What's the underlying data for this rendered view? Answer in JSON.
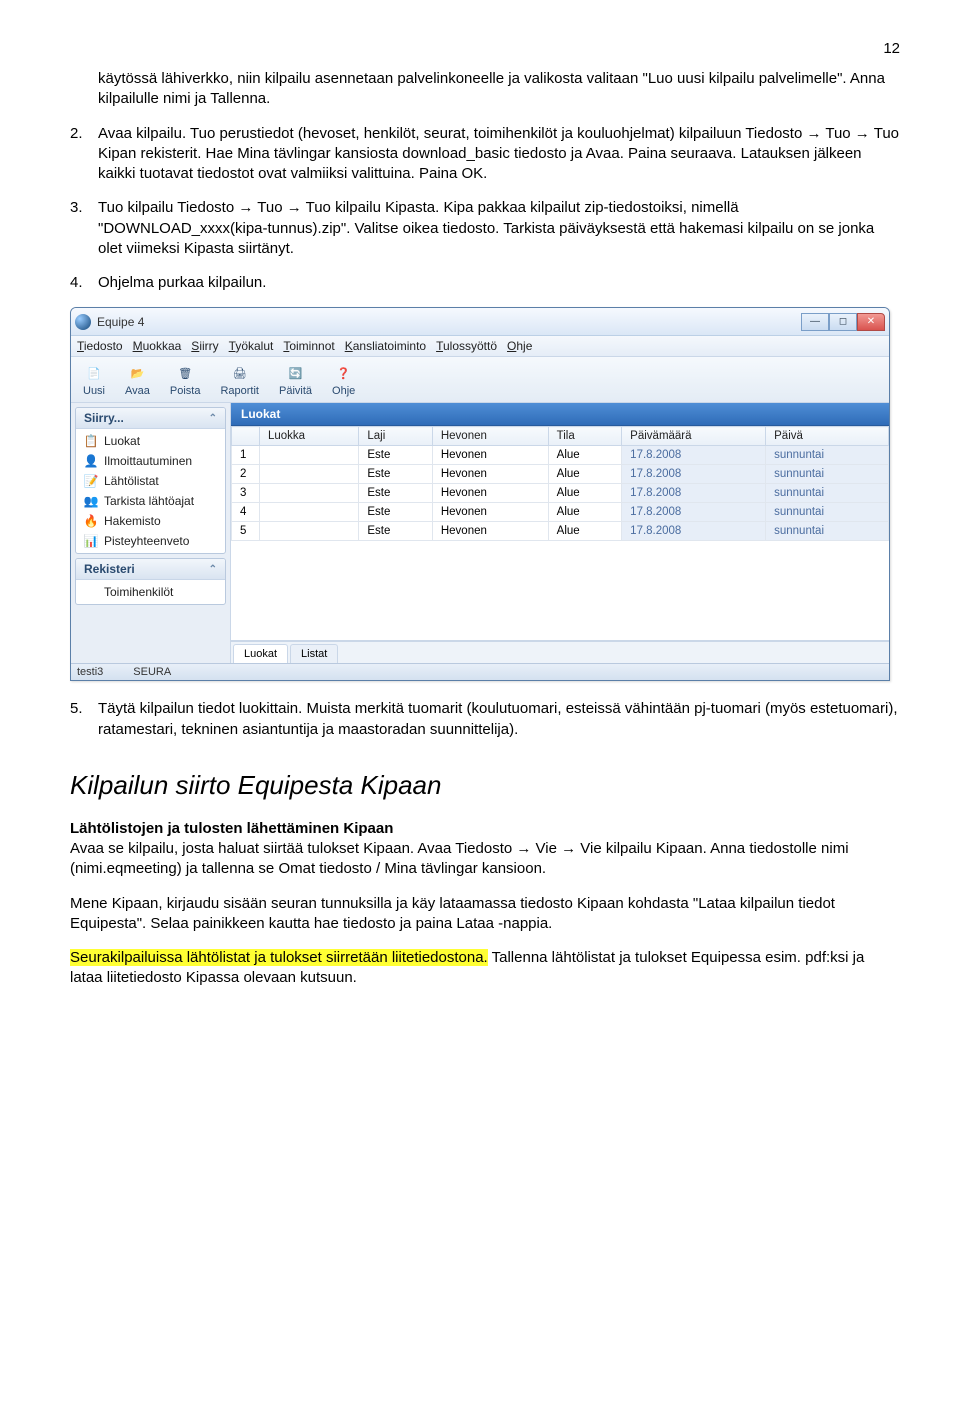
{
  "page_number": "12",
  "body": {
    "p1": "käytössä lähiverkko, niin kilpailu asennetaan palvelinkoneelle ja valikosta valitaan \"Luo uusi kilpailu palvelimelle\". Anna kilpailulle nimi ja Tallenna.",
    "n2": "2.",
    "p2": "Avaa kilpailu. Tuo perustiedot (hevoset, henkilöt, seurat, toimihenkilöt ja kouluohjelmat) kilpailuun Tiedosto → Tuo → Tuo Kipan rekisterit. Hae Mina tävlingar kansiosta download_basic tiedosto ja Avaa. Paina seuraava. Latauksen jälkeen kaikki tuotavat tiedostot ovat valmiiksi valittuina. Paina OK.",
    "n3": "3.",
    "p3": "Tuo kilpailu Tiedosto → Tuo → Tuo kilpailu Kipasta. Kipa pakkaa kilpailut zip-tiedostoiksi, nimellä \"DOWNLOAD_xxxx(kipa-tunnus).zip\". Valitse oikea tiedosto. Tarkista päiväyksestä että hakemasi kilpailu on se jonka olet viimeksi Kipasta siirtänyt.",
    "n4": "4.",
    "p4": "Ohjelma purkaa kilpailun.",
    "n5": "5.",
    "p5": "Täytä kilpailun tiedot luokittain. Muista merkitä tuomarit (koulutuomari, esteissä vähintään pj-tuomari (myös estetuomari), ratamestari, tekninen asiantuntija ja maastoradan suunnittelija)."
  },
  "section_heading": "Kilpailun siirto Equipesta Kipaan",
  "section": {
    "h1": "Lähtölistojen ja tulosten lähettäminen Kipaan",
    "h1_p": "Avaa se kilpailu, josta haluat siirtää tulokset Kipaan. Avaa Tiedosto → Vie → Vie kilpailu Kipaan. Anna tiedostolle nimi (nimi.eqmeeting) ja tallenna se Omat tiedosto / Mina tävlingar kansioon.",
    "p2a": "Mene Kipaan, kirjaudu sisään seuran tunnuksilla ja käy lataamassa tiedosto Kipaan kohdasta \"Lataa kilpailun tiedot Equipesta\". Selaa painikkeen kautta hae tiedosto ja paina Lataa -nappia.",
    "p3_hi": "Seurakilpailuissa lähtölistat ja tulokset siirretään liitetiedostona.",
    "p3_rest": " Tallenna lähtölistat ja tulokset Equipessa esim. pdf:ksi ja lataa liitetiedosto Kipassa olevaan kutsuun."
  },
  "screenshot": {
    "title": "Equipe 4",
    "menu": [
      "Tiedosto",
      "Muokkaa",
      "Siirry",
      "Työkalut",
      "Toiminnot",
      "Kansliatoiminto",
      "Tulossyöttö",
      "Ohje"
    ],
    "toolbar": [
      {
        "icon": "📄",
        "label": "Uusi"
      },
      {
        "icon": "📂",
        "label": "Avaa"
      },
      {
        "icon": "🗑",
        "label": "Poista"
      },
      {
        "icon": "🖨",
        "label": "Raportit"
      },
      {
        "icon": "🔄",
        "label": "Päivitä"
      },
      {
        "icon": "❓",
        "label": "Ohje"
      }
    ],
    "sidebar": {
      "panel1": {
        "title": "Siirry...",
        "items": [
          {
            "icon": "📋",
            "cls": "c-green",
            "label": "Luokat"
          },
          {
            "icon": "👤",
            "cls": "c-blue",
            "label": "Ilmoittautuminen"
          },
          {
            "icon": "📝",
            "cls": "c-orange",
            "label": "Lähtölistat"
          },
          {
            "icon": "👥",
            "cls": "c-purple",
            "label": "Tarkista lähtöajat"
          },
          {
            "icon": "🔥",
            "cls": "c-red",
            "label": "Hakemisto"
          },
          {
            "icon": "📊",
            "cls": "c-blue",
            "label": "Pisteyhteenveto"
          }
        ]
      },
      "panel2": {
        "title": "Rekisteri",
        "items": [
          {
            "icon": "",
            "cls": "",
            "label": "Toimihenkilöt"
          }
        ]
      }
    },
    "main": {
      "header": "Luokat",
      "columns": [
        "",
        "Luokka",
        "Laji",
        "Hevonen",
        "Tila",
        "Päivämäärä",
        "Päivä"
      ],
      "rows": [
        [
          "1",
          "",
          "Este",
          "Hevonen",
          "Alue",
          "17.8.2008",
          "sunnuntai"
        ],
        [
          "2",
          "",
          "Este",
          "Hevonen",
          "Alue",
          "17.8.2008",
          "sunnuntai"
        ],
        [
          "3",
          "",
          "Este",
          "Hevonen",
          "Alue",
          "17.8.2008",
          "sunnuntai"
        ],
        [
          "4",
          "",
          "Este",
          "Hevonen",
          "Alue",
          "17.8.2008",
          "sunnuntai"
        ],
        [
          "5",
          "",
          "Este",
          "Hevonen",
          "Alue",
          "17.8.2008",
          "sunnuntai"
        ]
      ],
      "subtabs": [
        "Luokat",
        "Listat"
      ]
    },
    "status": [
      "testi3",
      "SEURA"
    ]
  }
}
